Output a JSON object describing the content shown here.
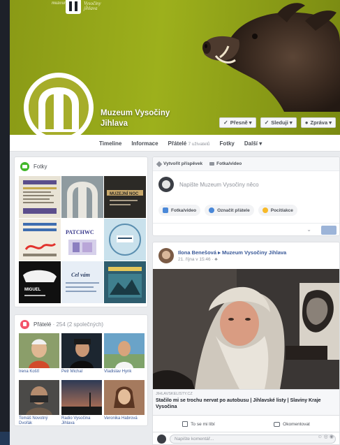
{
  "cover": {
    "logo_small": "muzeum",
    "logo_side": "Vysočiny jihlava"
  },
  "page": {
    "title_line1": "Muzeum Vysočiny",
    "title_line2": "Jihlava"
  },
  "cover_buttons": [
    {
      "label": "Přesně ▾",
      "icon": "check-icon"
    },
    {
      "label": "Sleduji ▾",
      "icon": "check-icon"
    },
    {
      "label": "Zpráva ▾",
      "icon": "dot-icon"
    }
  ],
  "tabs": [
    {
      "label": "Timeline",
      "active": false
    },
    {
      "label": "Informace",
      "active": false
    },
    {
      "label": "Přátelé",
      "sub": "7 uživatelů",
      "active": false
    },
    {
      "label": "Fotky",
      "active": false
    },
    {
      "label": "Další ▾",
      "active": false
    }
  ],
  "photos_card": {
    "title": "Fotky"
  },
  "photo_tiles": [
    {
      "text": "",
      "bg": "#e8e3d5"
    },
    {
      "text": "",
      "bg": "#8f9ba0"
    },
    {
      "text": "MUZEJNÍ NOC",
      "bg": "#2c2a26"
    },
    {
      "text": "",
      "bg": "#f1ece0"
    },
    {
      "text": "PATCHWC",
      "bg": "#ffffff"
    },
    {
      "text": "",
      "bg": "#c9e1ec"
    },
    {
      "text": "MIGUEL",
      "bg": "#101010"
    },
    {
      "text": "Cel vám",
      "bg": "#e7eef6"
    },
    {
      "text": "",
      "bg": "#2e5d6e"
    }
  ],
  "likes_card": {
    "title": "Přátelé",
    "muted": "· 254 (2 společných)"
  },
  "liked_pages": [
    {
      "name": "Irena Košťí",
      "bg": "#8b9e6a"
    },
    {
      "name": "Petr Michal",
      "bg": "#1c2630"
    },
    {
      "name": "Vladislav Hynk",
      "bg": "#6aa3c8"
    },
    {
      "name": "Tomáš Novotný Dvořák",
      "bg": "#4b4a48"
    },
    {
      "name": "Radio Vysočina Jihlava",
      "bg": "#2d3a55"
    },
    {
      "name": "Veronika Habrová",
      "bg": "#a57a5e"
    }
  ],
  "composer": {
    "tab_post": "Vytvořit příspěvek",
    "tab_photo": "Fotka/video",
    "placeholder": "Napište Muzeum Vysočiny něco",
    "actions": [
      {
        "label": "Fotka/video",
        "color": "#4a88d8"
      },
      {
        "label": "Označit přátele",
        "color": "#4a88d8"
      },
      {
        "label": "Pocit/akce",
        "color": "#f7b928"
      }
    ]
  },
  "post": {
    "author": "Ilona Benešová ▸ Muzeum Vysočiny Jihlava",
    "time": "21. října v 15:46 · ",
    "link_domain": "JIHLAVSKELISTY.CZ",
    "link_title": "Stačilo mi se trochu nervat po autobusu | Jihlavské listy | Slaviny Kraje Vysočina",
    "like_label": "To se mi líbí",
    "comment_label": "Okomentovat"
  },
  "comment": {
    "placeholder": "Napište komentář..."
  }
}
